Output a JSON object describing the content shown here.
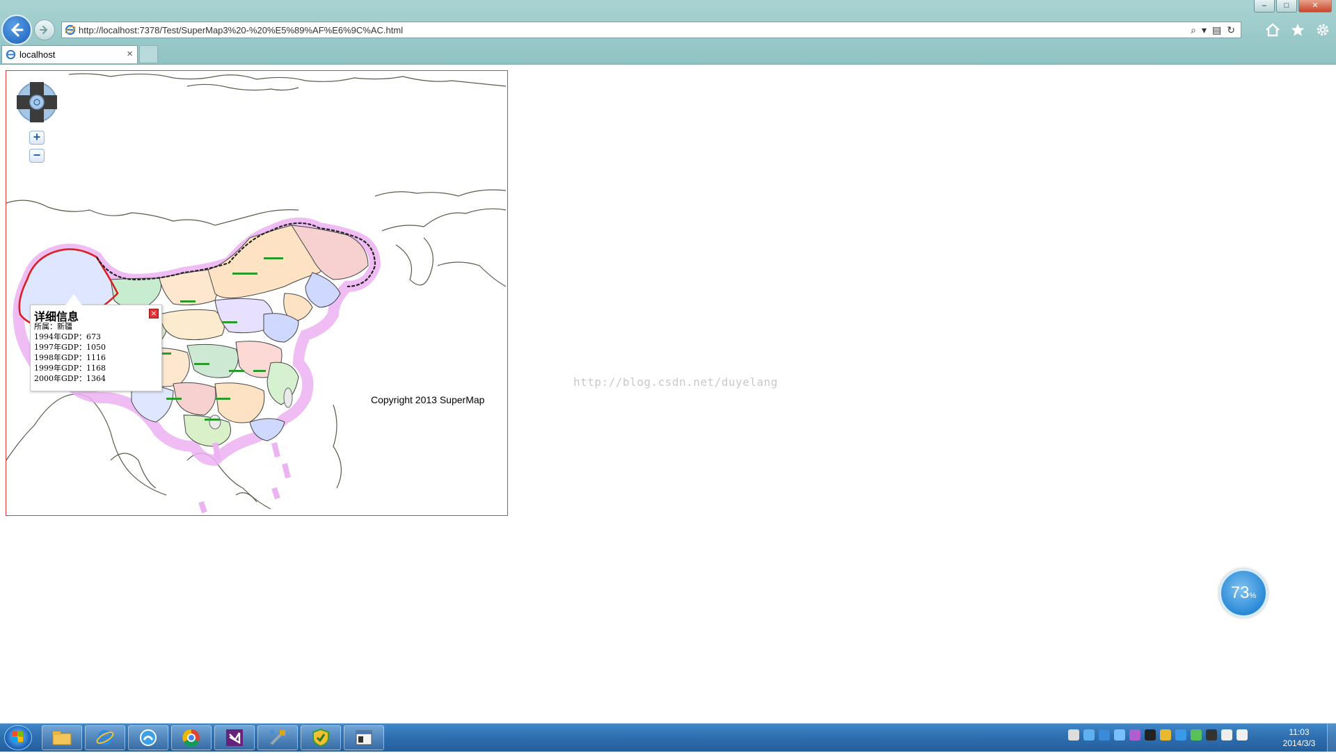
{
  "browser": {
    "address_url": "http://localhost:7378/Test/SuperMap3%20-%20%E5%89%AF%E6%9C%AC.html",
    "tab_title": "localhost",
    "tab_close": "×",
    "window_controls": {
      "minimize": "–",
      "maximize": "□",
      "close": "✕"
    }
  },
  "map": {
    "popup": {
      "title": "详细信息",
      "close": "×",
      "lines": [
        "所属：新疆",
        "1994年GDP：673",
        "1997年GDP：1050",
        "1998年GDP：1116",
        "1999年GDP：1168",
        "2000年GDP：1364"
      ]
    },
    "copyright": "Copyright 2013 SuperMap",
    "zoom_in": "+",
    "zoom_out": "−"
  },
  "page": {
    "watermark": "http://blog.csdn.net/duyelang"
  },
  "progress": {
    "value": "73",
    "unit": "%"
  },
  "taskbar": {
    "apps": [
      "file-explorer-icon",
      "internet-explorer-icon",
      "ie-download-icon",
      "chrome-icon",
      "visual-studio-icon",
      "tools-icon",
      "security-shield-icon",
      "window-app-icon"
    ],
    "clock_time": "11:03",
    "clock_date": "2014/3/3"
  },
  "colors": {
    "map_border": "#ee3333",
    "province_boundary_glow": "#e8a6f0",
    "popup_close": "#e23030",
    "taskbar": "#2f6fb0"
  }
}
